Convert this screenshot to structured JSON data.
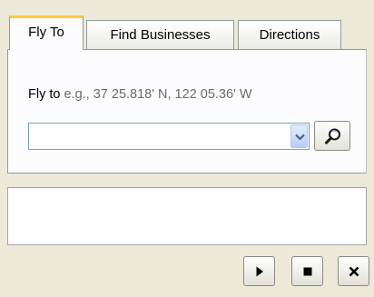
{
  "tabs": [
    {
      "label": "Fly To",
      "active": true
    },
    {
      "label": "Find Businesses",
      "active": false
    },
    {
      "label": "Directions",
      "active": false
    }
  ],
  "fly_to": {
    "label": "Fly to",
    "example": "e.g., 37 25.818' N, 122 05.36' W",
    "input_value": "",
    "search_icon": "magnifier-icon",
    "dropdown_icon": "chevron-down-icon"
  },
  "results": {
    "items": []
  },
  "controls": {
    "play_icon": "play-icon",
    "stop_icon": "stop-icon",
    "close_icon": "close-icon"
  },
  "colors": {
    "active_tab_accent": "#ffc83c",
    "window_background": "#ece9d8",
    "panel_background": "#fcfcfe",
    "field_border": "#7f9db9"
  }
}
